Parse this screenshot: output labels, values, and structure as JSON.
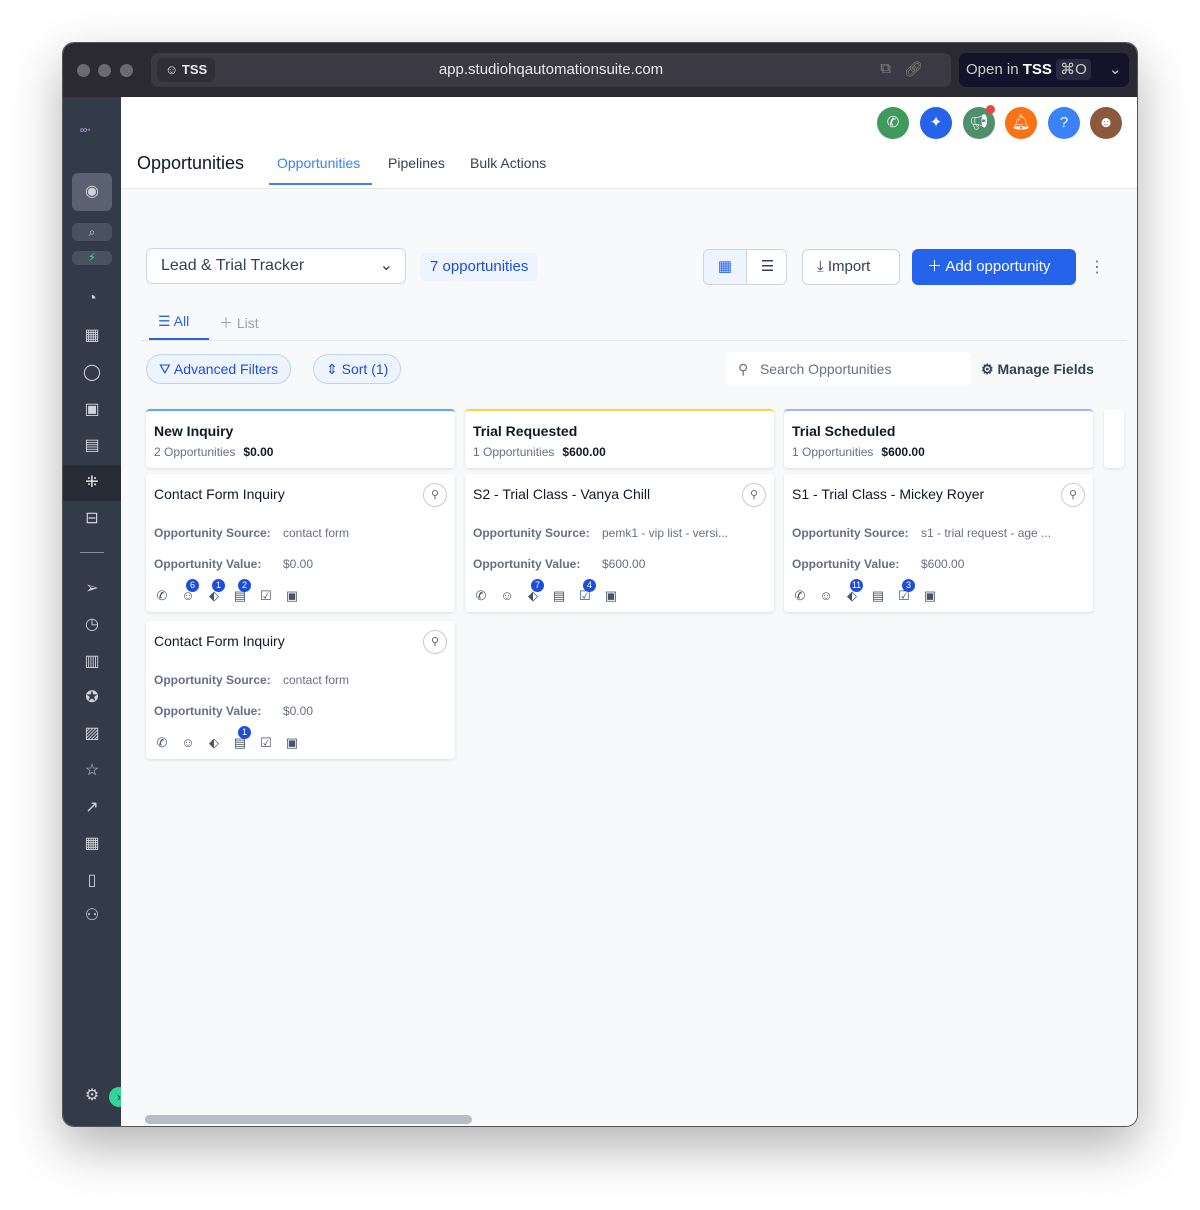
{
  "browser": {
    "badge": "TSS",
    "url": "app.studiohqautomationsuite.com",
    "open_in": "Open in",
    "open_app": "TSS",
    "shortcut": "⌘O"
  },
  "header": {
    "title": "Opportunities",
    "tabs": [
      {
        "label": "Opportunities",
        "active": true
      },
      {
        "label": "Pipelines"
      },
      {
        "label": "Bulk Actions"
      }
    ]
  },
  "toolbar": {
    "pipeline": "Lead & Trial Tracker",
    "count": "7 opportunities",
    "import": "Import",
    "add": "Add opportunity"
  },
  "views": {
    "all": "All",
    "list": "List"
  },
  "filters": {
    "advanced": "Advanced Filters",
    "sort": "Sort (1)",
    "search_placeholder": "Search Opportunities",
    "manage": "Manage Fields"
  },
  "colors": {
    "accent": "#2563eb",
    "sidebar": "#343b48"
  },
  "columns": [
    {
      "name": "New Inquiry",
      "count": "2 Opportunities",
      "value": "$0.00",
      "color": "#60a5fa",
      "cards": [
        {
          "title": "Contact Form Inquiry",
          "source_label": "Opportunity Source:",
          "source": "contact form",
          "value_label": "Opportunity Value:",
          "value": "$0.00",
          "badges": [
            "",
            "6",
            "1",
            "2",
            "",
            ""
          ]
        },
        {
          "title": "Contact Form Inquiry",
          "source_label": "Opportunity Source:",
          "source": "contact form",
          "value_label": "Opportunity Value:",
          "value": "$0.00",
          "badges": [
            "",
            "",
            "",
            "1",
            "",
            ""
          ]
        }
      ]
    },
    {
      "name": "Trial Requested",
      "count": "1 Opportunities",
      "value": "$600.00",
      "color": "#fcd34d",
      "cards": [
        {
          "title": "S2 - Trial Class - Vanya Chill",
          "source_label": "Opportunity Source:",
          "source": "pemk1 - vip list - versi...",
          "value_label": "Opportunity Value:",
          "value": "$600.00",
          "badges": [
            "",
            "",
            "7",
            "",
            "4",
            ""
          ]
        }
      ]
    },
    {
      "name": "Trial Scheduled",
      "count": "1 Opportunities",
      "value": "$600.00",
      "color": "#a5b4fc",
      "cards": [
        {
          "title": "S1 - Trial Class - Mickey Royer",
          "source_label": "Opportunity Source:",
          "source": "s1 - trial request - age ...",
          "value_label": "Opportunity Value:",
          "value": "$600.00",
          "badges": [
            "",
            "",
            "11",
            "",
            "3",
            ""
          ]
        }
      ]
    }
  ]
}
